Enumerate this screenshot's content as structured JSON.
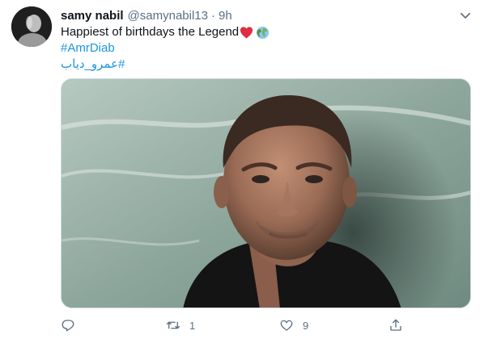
{
  "tweet": {
    "author_name": "samy nabil",
    "author_handle": "@samynabil13",
    "separator": "·",
    "time": "9h",
    "text": "Happiest of birthdays the Legend",
    "emojis": [
      "red-heart",
      "globe"
    ],
    "hashtags": [
      "#AmrDiab",
      "#عمرو_دياب"
    ],
    "actions": {
      "reply_count": "",
      "retweet_count": "1",
      "like_count": "9"
    }
  },
  "colors": {
    "text": "#0f1419",
    "secondary": "#5b7083",
    "link": "#1b95e0",
    "heart": "#e0245e"
  },
  "icons": [
    "more-caret-icon",
    "reply-icon",
    "retweet-icon",
    "like-icon",
    "share-icon"
  ]
}
